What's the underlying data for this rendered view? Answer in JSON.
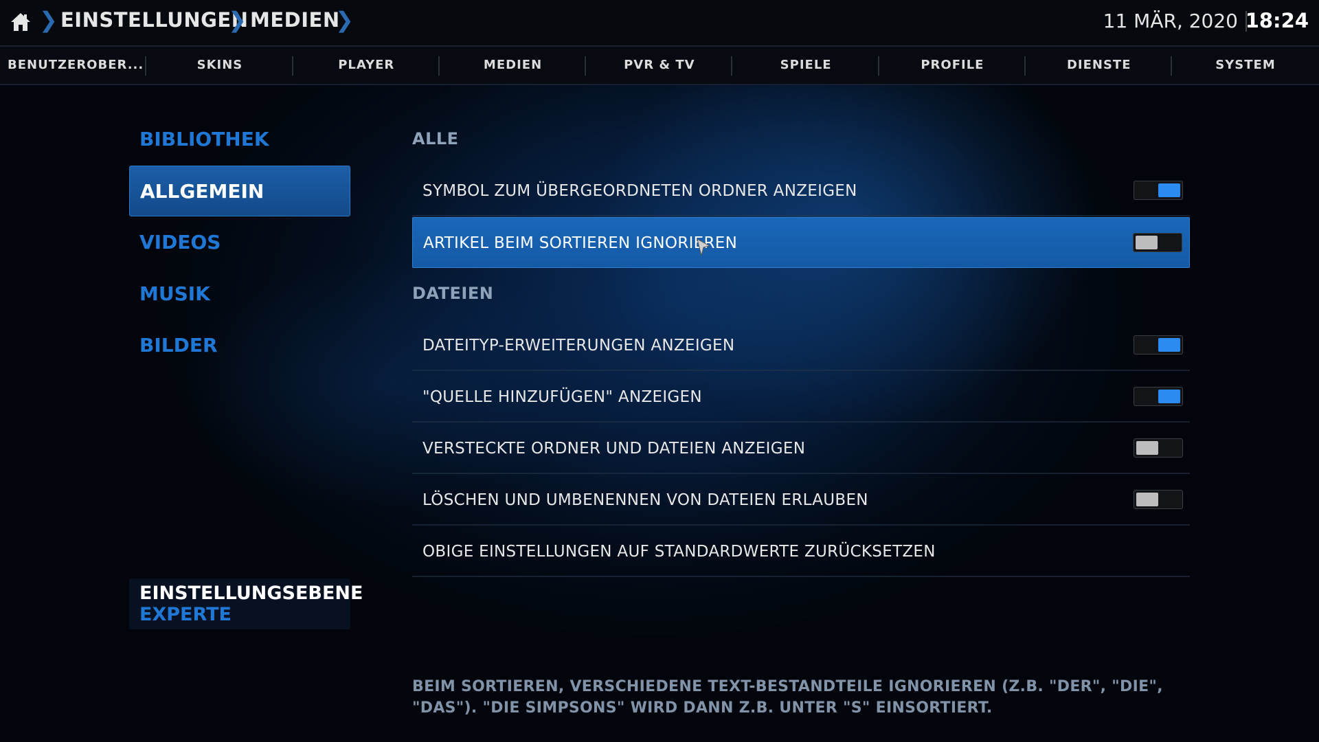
{
  "breadcrumb": {
    "home_icon": "home-icon",
    "items": [
      "EINSTELLUNGEN",
      "MEDIEN"
    ]
  },
  "clock": {
    "date": "11 MÄR, 2020",
    "time": "18:24"
  },
  "tabs": [
    "BENUTZEROBER...",
    "SKINS",
    "PLAYER",
    "MEDIEN",
    "PVR & TV",
    "SPIELE",
    "PROFILE",
    "DIENSTE",
    "SYSTEM"
  ],
  "categories": [
    {
      "label": "BIBLIOTHEK",
      "selected": false
    },
    {
      "label": "ALLGEMEIN",
      "selected": true
    },
    {
      "label": "VIDEOS",
      "selected": false
    },
    {
      "label": "MUSIK",
      "selected": false
    },
    {
      "label": "BILDER",
      "selected": false
    }
  ],
  "settings_level": {
    "title": "EINSTELLUNGSEBENE",
    "value": "EXPERTE"
  },
  "sections": [
    {
      "heading": "ALLE",
      "items": [
        {
          "label": "SYMBOL ZUM ÜBERGEORDNETEN ORDNER ANZEIGEN",
          "toggle": "on",
          "focused": false
        },
        {
          "label": "ARTIKEL BEIM SORTIEREN IGNORIEREN",
          "toggle": "off",
          "focused": true
        }
      ]
    },
    {
      "heading": "DATEIEN",
      "items": [
        {
          "label": "DATEITYP-ERWEITERUNGEN ANZEIGEN",
          "toggle": "on",
          "focused": false
        },
        {
          "label": "\"QUELLE HINZUFÜGEN\" ANZEIGEN",
          "toggle": "on",
          "focused": false
        },
        {
          "label": "VERSTECKTE ORDNER UND DATEIEN ANZEIGEN",
          "toggle": "off",
          "focused": false
        },
        {
          "label": "LÖSCHEN UND UMBENENNEN VON DATEIEN ERLAUBEN",
          "toggle": "off",
          "focused": false
        },
        {
          "label": "OBIGE EINSTELLUNGEN AUF STANDARDWERTE ZURÜCKSETZEN",
          "toggle": null,
          "focused": false
        }
      ]
    }
  ],
  "help_text": "BEIM SORTIEREN, VERSCHIEDENE TEXT-BESTANDTEILE IGNORIEREN (Z.B. \"DER\", \"DIE\", \"DAS\").  \"DIE SIMPSONS\" WIRD DANN Z.B. UNTER \"S\" EINSORTIERT.",
  "colors": {
    "accent": "#1f78d6",
    "focus": "#1a66b8",
    "toggle_on": "#2b8bf0",
    "toggle_off": "#bdbdbd"
  }
}
